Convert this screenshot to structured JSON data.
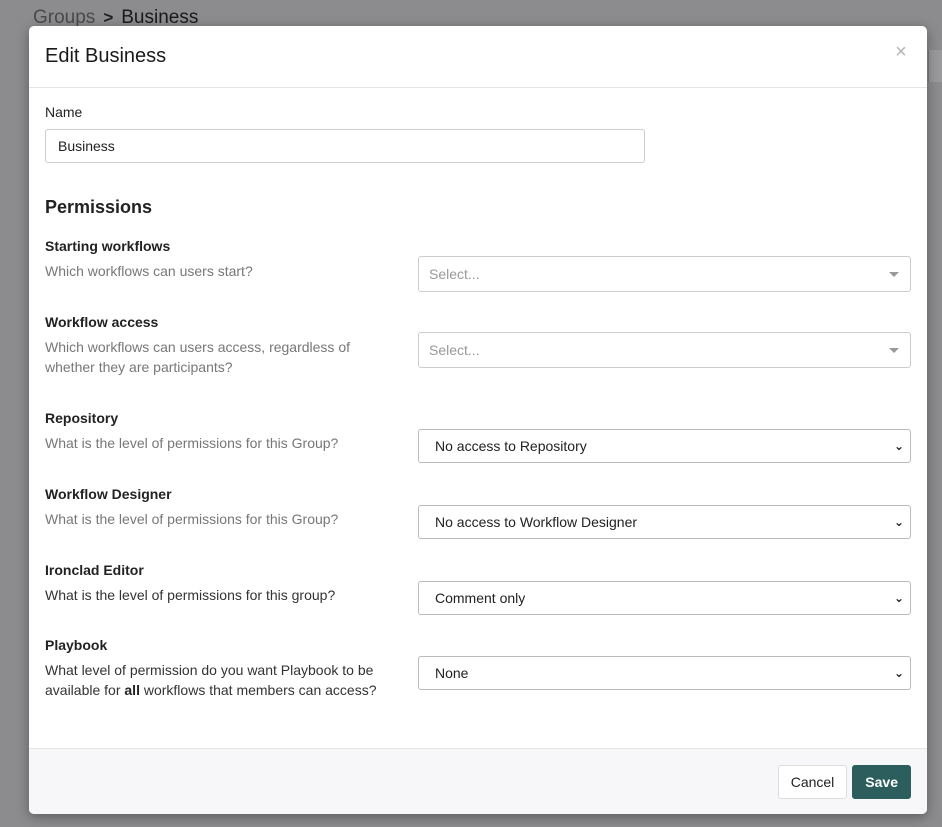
{
  "backdrop": {
    "breadcrumb_parent": "Groups",
    "breadcrumb_separator": ">",
    "breadcrumb_current": "Business"
  },
  "modal": {
    "title": "Edit Business",
    "close_icon": "×",
    "name_label": "Name",
    "name_value": "Business",
    "permissions_title": "Permissions"
  },
  "permissions": [
    {
      "title": "Starting workflows",
      "description": "Which workflows can users start?",
      "control": "multiselect",
      "placeholder": "Select..."
    },
    {
      "title": "Workflow access",
      "description": "Which workflows can users access, regardless of whether they are participants?",
      "control": "multiselect",
      "placeholder": "Select..."
    },
    {
      "title": "Repository",
      "description": "What is the level of permissions for this Group?",
      "control": "select",
      "value": "No access to Repository"
    },
    {
      "title": "Workflow Designer",
      "description": "What is the level of permissions for this Group?",
      "control": "select",
      "value": "No access to Workflow Designer"
    },
    {
      "title": "Ironclad Editor",
      "description": "What is the level of permissions for this group?",
      "control": "select",
      "value": "Comment only"
    },
    {
      "title": "Playbook",
      "description_before": "What level of permission do you want Playbook to be available for ",
      "description_bold": "all",
      "description_after": " workflows that members can access?",
      "control": "select",
      "value": "None"
    }
  ],
  "footer": {
    "cancel_label": "Cancel",
    "save_label": "Save"
  },
  "colors": {
    "save_button": "#2b5e5c",
    "backdrop": "#8c8c8e"
  }
}
